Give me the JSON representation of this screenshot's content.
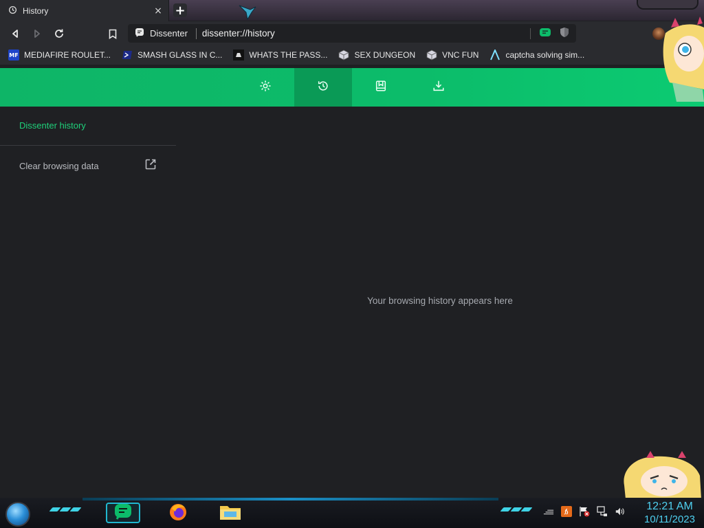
{
  "browser": {
    "tab": {
      "title": "History",
      "close_glyph": "×"
    },
    "new_tab_glyph": "+",
    "omnibox": {
      "site_name": "Dissenter",
      "url": "dissenter://history"
    }
  },
  "bookmarks": [
    {
      "label": "MEDIAFIRE ROULET...",
      "icon": "mediafire-icon",
      "icon_text": "MF"
    },
    {
      "label": "SMASH GLASS IN C...",
      "icon": "powershell-icon",
      "icon_text": ""
    },
    {
      "label": "WHATS THE PASS...",
      "icon": "dark-site-icon",
      "icon_text": ""
    },
    {
      "label": "SEX DUNGEON",
      "icon": "cube-icon",
      "icon_text": ""
    },
    {
      "label": "VNC FUN",
      "icon": "cube-icon",
      "icon_text": ""
    },
    {
      "label": "captcha solving sim...",
      "icon": "triangle-logo-icon",
      "icon_text": ""
    }
  ],
  "header_nav": {
    "items": [
      {
        "name": "settings",
        "icon": "gear-icon",
        "active": false
      },
      {
        "name": "history",
        "icon": "history-clock-icon",
        "active": true
      },
      {
        "name": "bookmarks",
        "icon": "bookmark-icon",
        "active": false
      },
      {
        "name": "downloads",
        "icon": "download-icon",
        "active": false
      }
    ]
  },
  "sidebar": {
    "title": "Dissenter history",
    "clear_label": "Clear browsing data"
  },
  "main": {
    "empty_message": "Your browsing history appears here"
  },
  "taskbar": {
    "time": "12:21 AM",
    "date": "10/11/2023"
  },
  "colors": {
    "accent_green": "#0cbc6a",
    "active_green": "#0a9a56",
    "sidebar_title": "#1fd07a",
    "clock": "#4fd0f0"
  }
}
